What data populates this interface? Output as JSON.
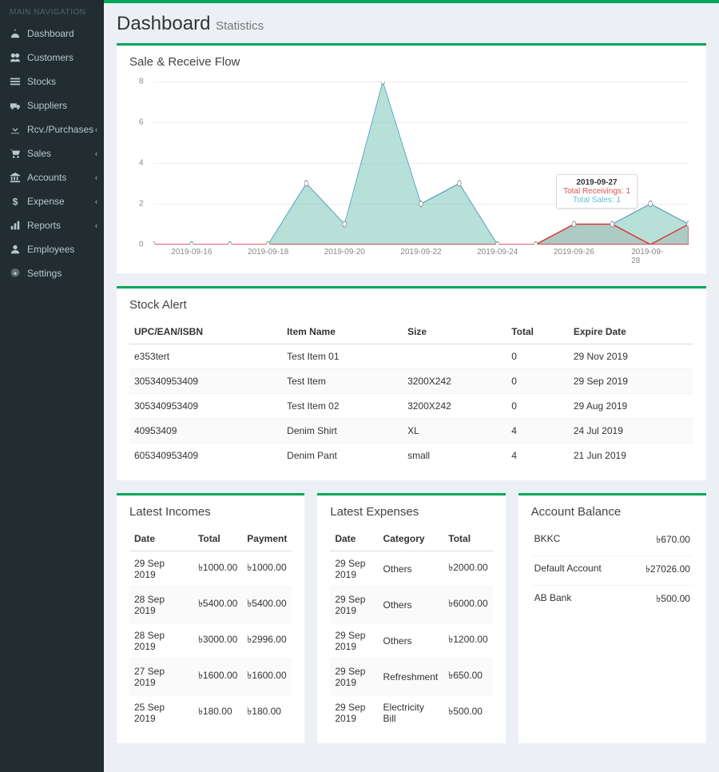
{
  "sidebar": {
    "header": "MAIN NAVIGATION",
    "items": [
      {
        "label": "Dashboard",
        "icon": "dashboard-icon",
        "expand": false
      },
      {
        "label": "Customers",
        "icon": "users-icon",
        "expand": false
      },
      {
        "label": "Stocks",
        "icon": "list-icon",
        "expand": false
      },
      {
        "label": "Suppliers",
        "icon": "truck-icon",
        "expand": false
      },
      {
        "label": "Rcv./Purchases",
        "icon": "download-icon",
        "expand": true
      },
      {
        "label": "Sales",
        "icon": "cart-icon",
        "expand": true
      },
      {
        "label": "Accounts",
        "icon": "bank-icon",
        "expand": true
      },
      {
        "label": "Expense",
        "icon": "dollar-icon",
        "expand": true
      },
      {
        "label": "Reports",
        "icon": "report-icon",
        "expand": true
      },
      {
        "label": "Employees",
        "icon": "user-icon",
        "expand": false
      },
      {
        "label": "Settings",
        "icon": "gear-icon",
        "expand": false
      }
    ]
  },
  "header": {
    "title": "Dashboard",
    "subtitle": "Statistics"
  },
  "chart_panel": {
    "title": "Sale & Receive Flow"
  },
  "chart_data": {
    "type": "area",
    "x": [
      "2019-09-15",
      "2019-09-16",
      "2019-09-17",
      "2019-09-18",
      "2019-09-19",
      "2019-09-20",
      "2019-09-21",
      "2019-09-22",
      "2019-09-23",
      "2019-09-24",
      "2019-09-25",
      "2019-09-26",
      "2019-09-27",
      "2019-09-28",
      "2019-09-29"
    ],
    "x_ticks": [
      "2019-09-16",
      "2019-09-18",
      "2019-09-20",
      "2019-09-22",
      "2019-09-24",
      "2019-09-26",
      "2019-09-28"
    ],
    "series": [
      {
        "name": "Total Sales",
        "values": [
          0,
          0,
          0,
          0,
          3,
          1,
          8,
          2,
          3,
          0,
          0,
          1,
          1,
          2,
          1
        ],
        "color": "#7ac6b8"
      },
      {
        "name": "Total Receivings",
        "values": [
          0,
          0,
          0,
          0,
          0,
          0,
          0,
          0,
          0,
          0,
          0,
          1,
          1,
          0,
          1
        ],
        "color": "#d9534f"
      }
    ],
    "ylim": [
      0,
      8
    ],
    "y_ticks": [
      0,
      2,
      4,
      6,
      8
    ],
    "tooltip": {
      "date": "2019-09-27",
      "receivings_label": "Total Receivings:",
      "receivings_val": "1",
      "sales_label": "Total Sales:",
      "sales_val": "1"
    }
  },
  "stock_alert": {
    "title": "Stock Alert",
    "columns": [
      "UPC/EAN/ISBN",
      "Item Name",
      "Size",
      "Total",
      "Expire Date"
    ],
    "rows": [
      {
        "upc": "e353tert",
        "name": "Test Item 01",
        "size": "",
        "total": "0",
        "exp": "29 Nov 2019"
      },
      {
        "upc": "305340953409",
        "name": "Test Item",
        "size": "3200X242",
        "total": "0",
        "exp": "29 Sep 2019"
      },
      {
        "upc": "305340953409",
        "name": "Test Item 02",
        "size": "3200X242",
        "total": "0",
        "exp": "29 Aug 2019"
      },
      {
        "upc": "40953409",
        "name": "Denim Shirt",
        "size": "XL",
        "total": "4",
        "exp": "24 Jul 2019"
      },
      {
        "upc": "605340953409",
        "name": "Denim Pant",
        "size": "small",
        "total": "4",
        "exp": "21 Jun 2019"
      }
    ]
  },
  "incomes": {
    "title": "Latest Incomes",
    "columns": [
      "Date",
      "Total",
      "Payment"
    ],
    "rows": [
      {
        "date": "29 Sep 2019",
        "total": "৳1000.00",
        "pay": "৳1000.00"
      },
      {
        "date": "28 Sep 2019",
        "total": "৳5400.00",
        "pay": "৳5400.00"
      },
      {
        "date": "28 Sep 2019",
        "total": "৳3000.00",
        "pay": "৳2996.00"
      },
      {
        "date": "27 Sep 2019",
        "total": "৳1600.00",
        "pay": "৳1600.00"
      },
      {
        "date": "25 Sep 2019",
        "total": "৳180.00",
        "pay": "৳180.00"
      }
    ]
  },
  "expenses": {
    "title": "Latest Expenses",
    "columns": [
      "Date",
      "Category",
      "Total"
    ],
    "rows": [
      {
        "date": "29 Sep 2019",
        "cat": "Others",
        "total": "৳2000.00"
      },
      {
        "date": "29 Sep 2019",
        "cat": "Others",
        "total": "৳6000.00"
      },
      {
        "date": "29 Sep 2019",
        "cat": "Others",
        "total": "৳1200.00"
      },
      {
        "date": "29 Sep 2019",
        "cat": "Refreshment",
        "total": "৳650.00"
      },
      {
        "date": "29 Sep 2019",
        "cat": "Electricity Bill",
        "total": "৳500.00"
      }
    ]
  },
  "balance": {
    "title": "Account Balance",
    "rows": [
      {
        "name": "BKKC",
        "val": "৳670.00"
      },
      {
        "name": "Default Account",
        "val": "৳27026.00"
      },
      {
        "name": "AB Bank",
        "val": "৳500.00"
      }
    ]
  }
}
